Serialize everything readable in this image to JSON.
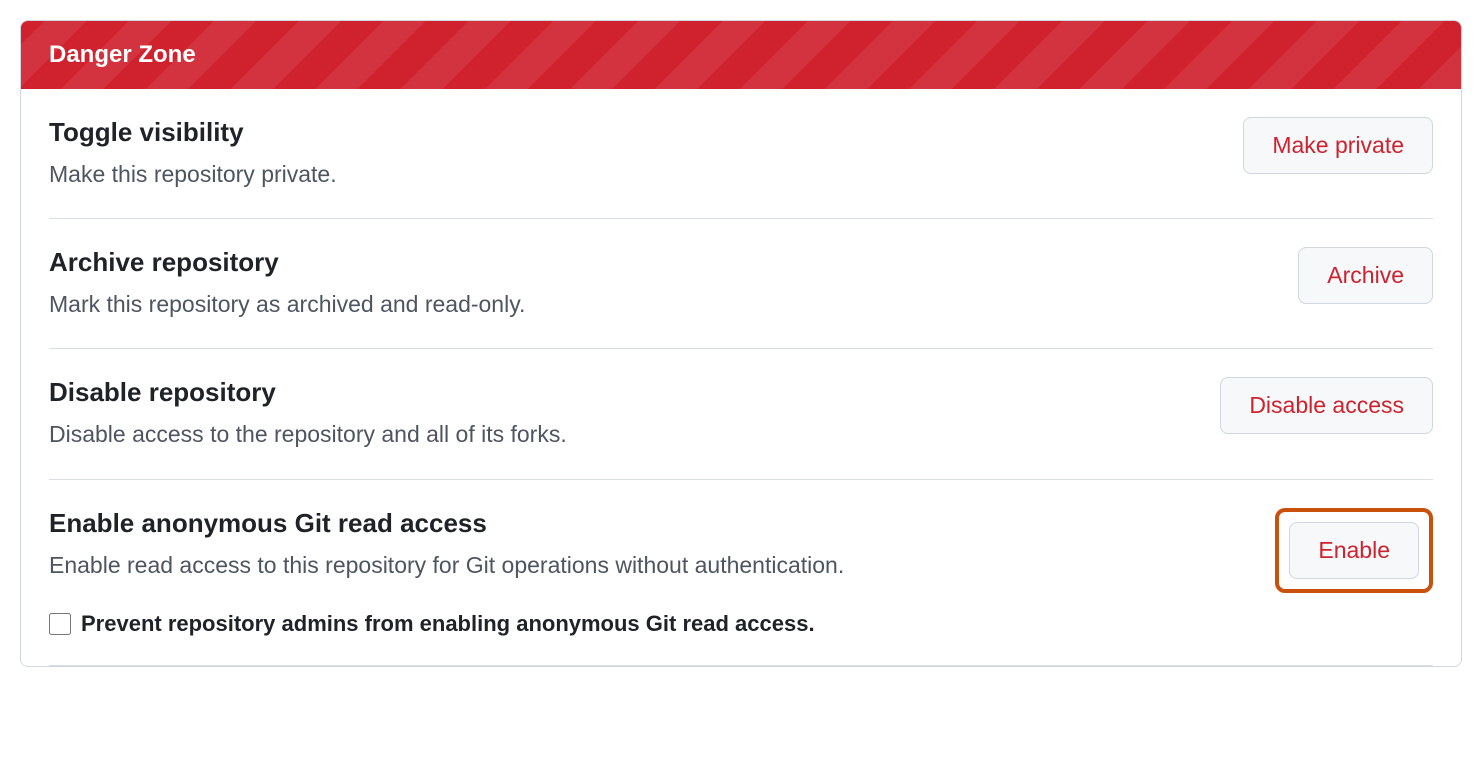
{
  "dangerZone": {
    "header": "Danger Zone",
    "items": [
      {
        "title": "Toggle visibility",
        "desc": "Make this repository private.",
        "button": "Make private"
      },
      {
        "title": "Archive repository",
        "desc": "Mark this repository as archived and read-only.",
        "button": "Archive"
      },
      {
        "title": "Disable repository",
        "desc": "Disable access to the repository and all of its forks.",
        "button": "Disable access"
      },
      {
        "title": "Enable anonymous Git read access",
        "desc": "Enable read access to this repository for Git operations without authentication.",
        "button": "Enable",
        "checkboxLabel": "Prevent repository admins from enabling anonymous Git read access."
      }
    ]
  }
}
